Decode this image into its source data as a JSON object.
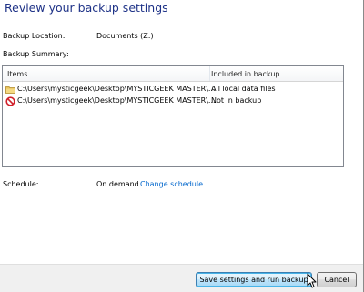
{
  "dialog": {
    "title": "Review your backup settings"
  },
  "backup_location": {
    "label": "Backup Location:",
    "value": "Documents (Z:)"
  },
  "backup_summary": {
    "label": "Backup Summary:",
    "columns": [
      "Items",
      "Included in backup"
    ],
    "rows": [
      {
        "icon": "folder-icon",
        "path": "C:\\Users\\mysticgeek\\Desktop\\MYSTICGEEK MASTER\\...",
        "status": "All local data files"
      },
      {
        "icon": "excluded-icon",
        "path": "C:\\Users\\mysticgeek\\Desktop\\MYSTICGEEK MASTER\\...",
        "status": "Not in backup"
      }
    ]
  },
  "schedule": {
    "label": "Schedule:",
    "value": "On demand",
    "change_link": "Change schedule"
  },
  "buttons": {
    "save_run": "Save settings and run backup",
    "cancel": "Cancel"
  },
  "colors": {
    "title": "#1e3287",
    "link": "#0066cc",
    "footer": "#f0f0f0"
  }
}
